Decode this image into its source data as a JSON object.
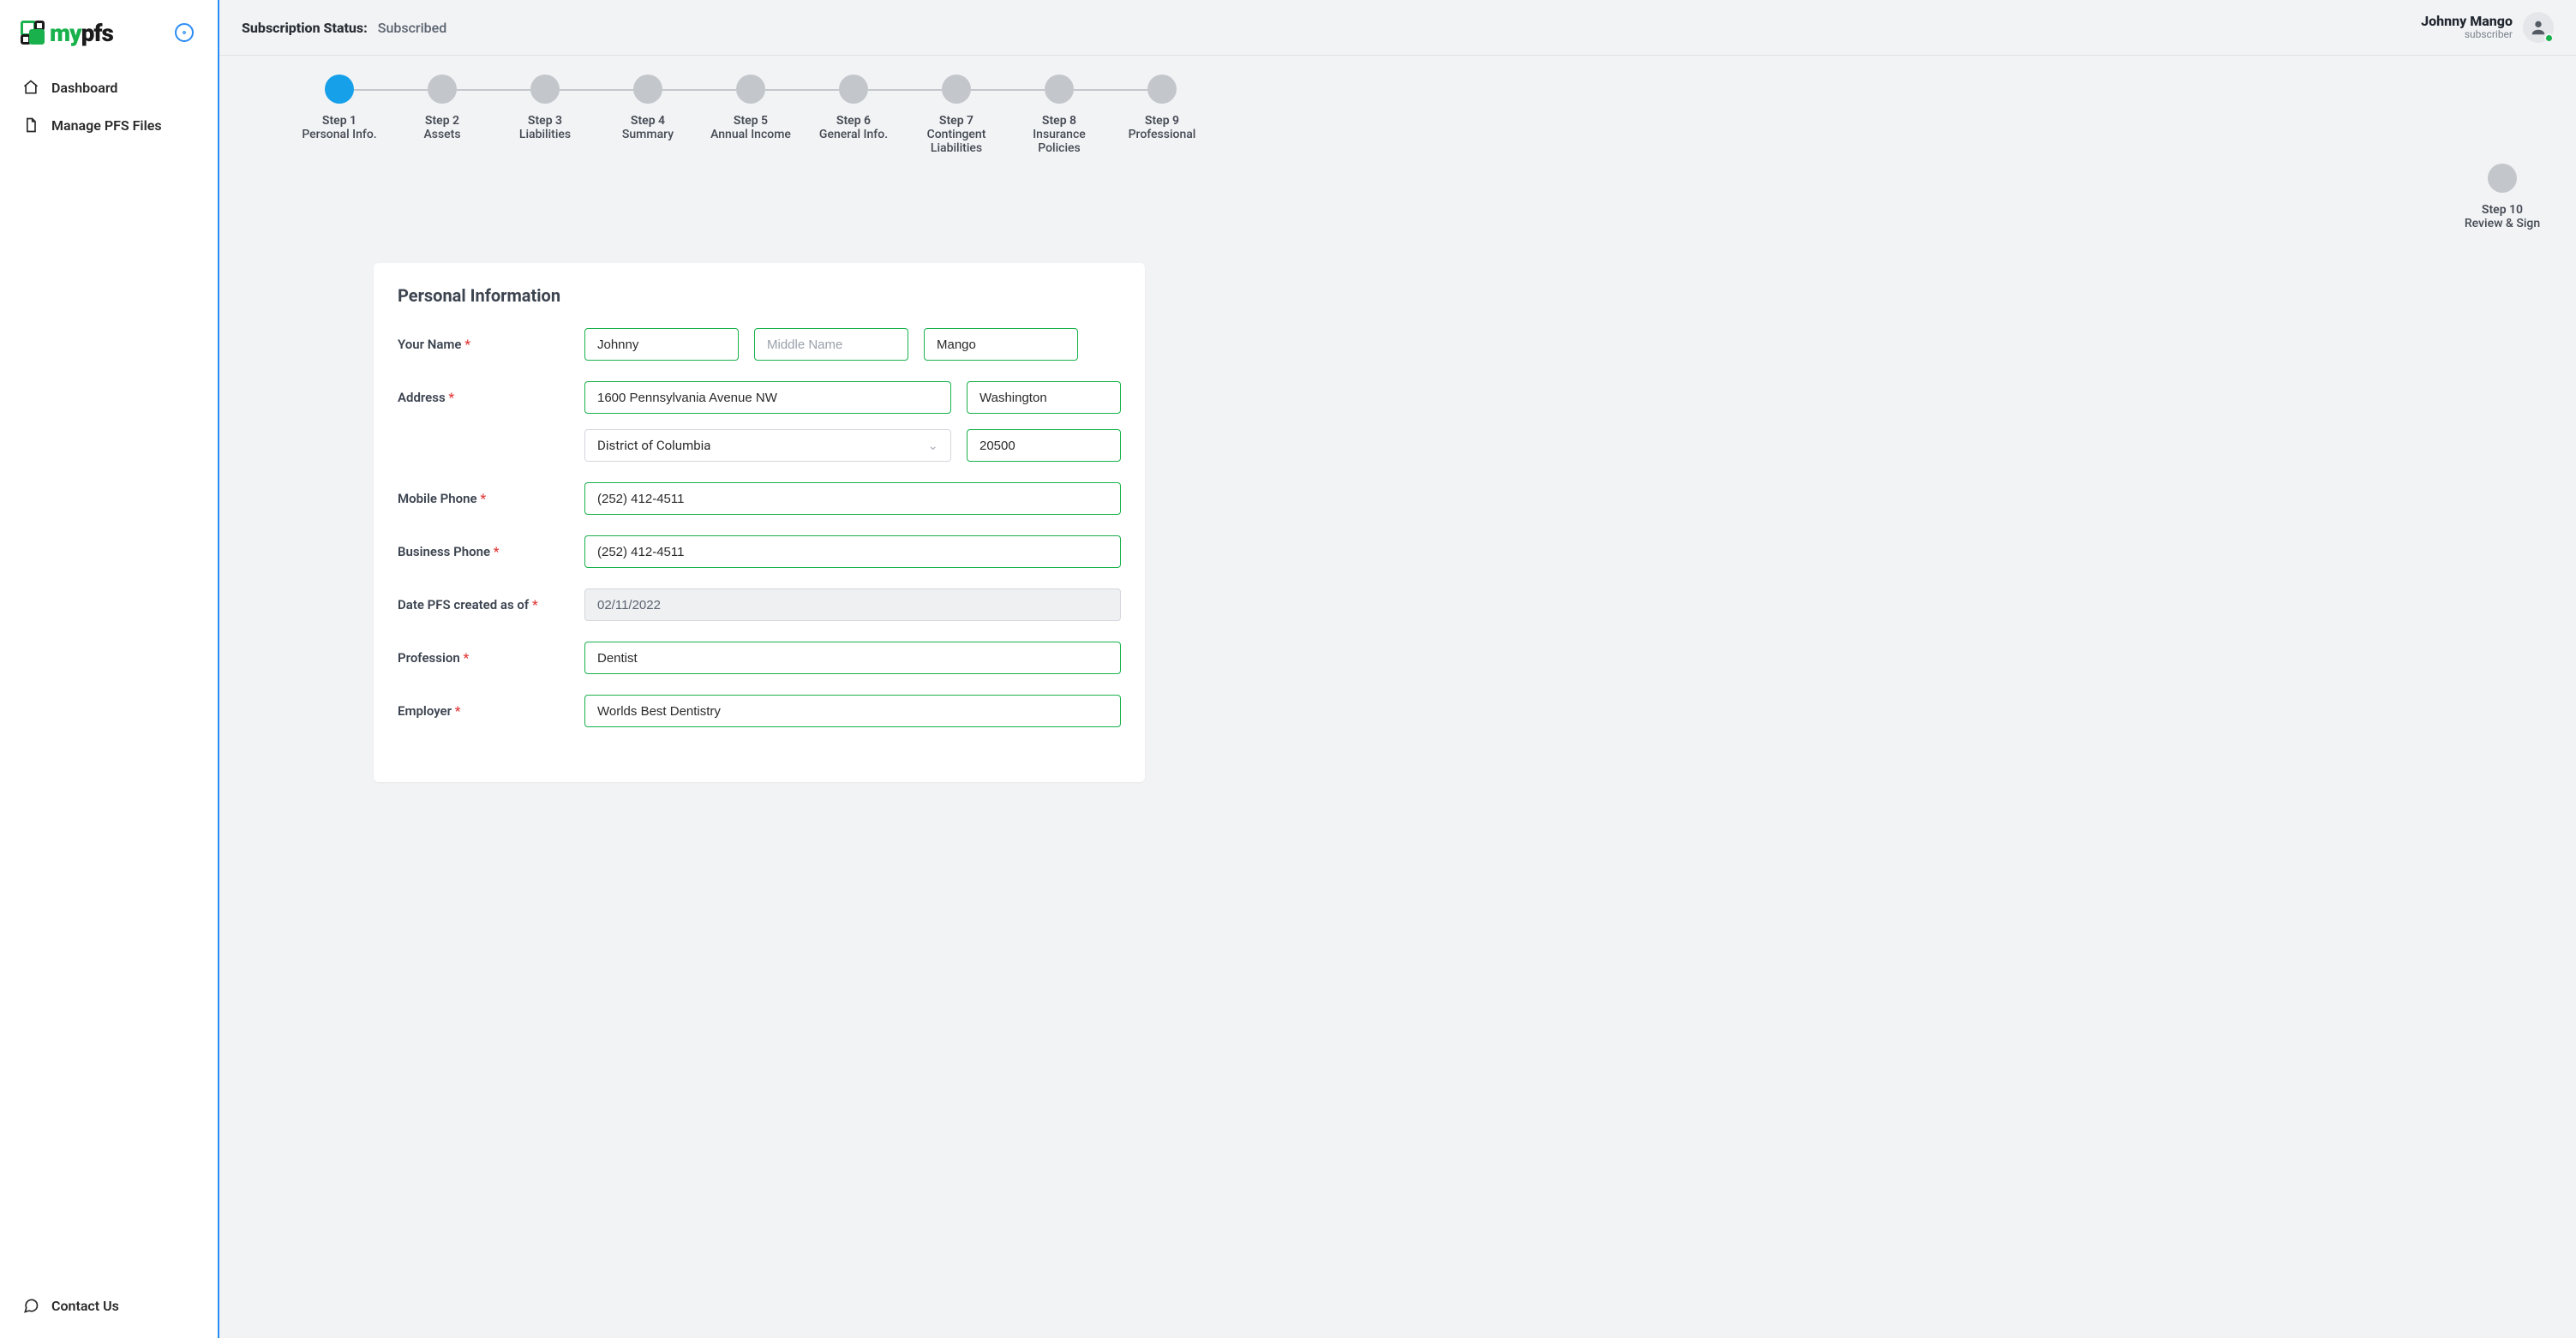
{
  "brand": {
    "my": "my",
    "pfs": "pfs"
  },
  "sidebar": {
    "items": [
      {
        "label": "Dashboard",
        "icon": "home-icon"
      },
      {
        "label": "Manage PFS Files",
        "icon": "file-icon"
      }
    ],
    "footer": {
      "label": "Contact Us",
      "icon": "chat-icon"
    }
  },
  "topbar": {
    "subscription_label": "Subscription Status:",
    "subscription_value": "Subscribed",
    "user_name": "Johnny Mango",
    "user_role": "subscriber"
  },
  "stepper": [
    {
      "step": "Step 1",
      "title": "Personal Info.",
      "active": true
    },
    {
      "step": "Step 2",
      "title": "Assets",
      "active": false
    },
    {
      "step": "Step 3",
      "title": "Liabilities",
      "active": false
    },
    {
      "step": "Step 4",
      "title": "Summary",
      "active": false
    },
    {
      "step": "Step 5",
      "title": "Annual Income",
      "active": false
    },
    {
      "step": "Step 6",
      "title": "General Info.",
      "active": false
    },
    {
      "step": "Step 7",
      "title": "Contingent Liabilities",
      "active": false
    },
    {
      "step": "Step 8",
      "title": "Insurance Policies",
      "active": false
    },
    {
      "step": "Step 9",
      "title": "Professional",
      "active": false
    },
    {
      "step": "Step 10",
      "title": "Review & Sign",
      "active": false
    }
  ],
  "form": {
    "section_title": "Personal Information",
    "labels": {
      "your_name": "Your Name",
      "address": "Address",
      "mobile": "Mobile Phone",
      "business": "Business Phone",
      "date": "Date PFS created as of",
      "profession": "Profession",
      "employer": "Employer"
    },
    "required_mark": "*",
    "values": {
      "first_name": "Johnny",
      "middle_name": "",
      "middle_name_placeholder": "Middle Name",
      "last_name": "Mango",
      "street": "1600 Pennsylvania Avenue NW",
      "city": "Washington",
      "state": "District of Columbia",
      "zip": "20500",
      "mobile": "(252) 412-4511",
      "business": "(252) 412-4511",
      "date": "02/11/2022",
      "profession": "Dentist",
      "employer": "Worlds Best Dentistry"
    }
  }
}
